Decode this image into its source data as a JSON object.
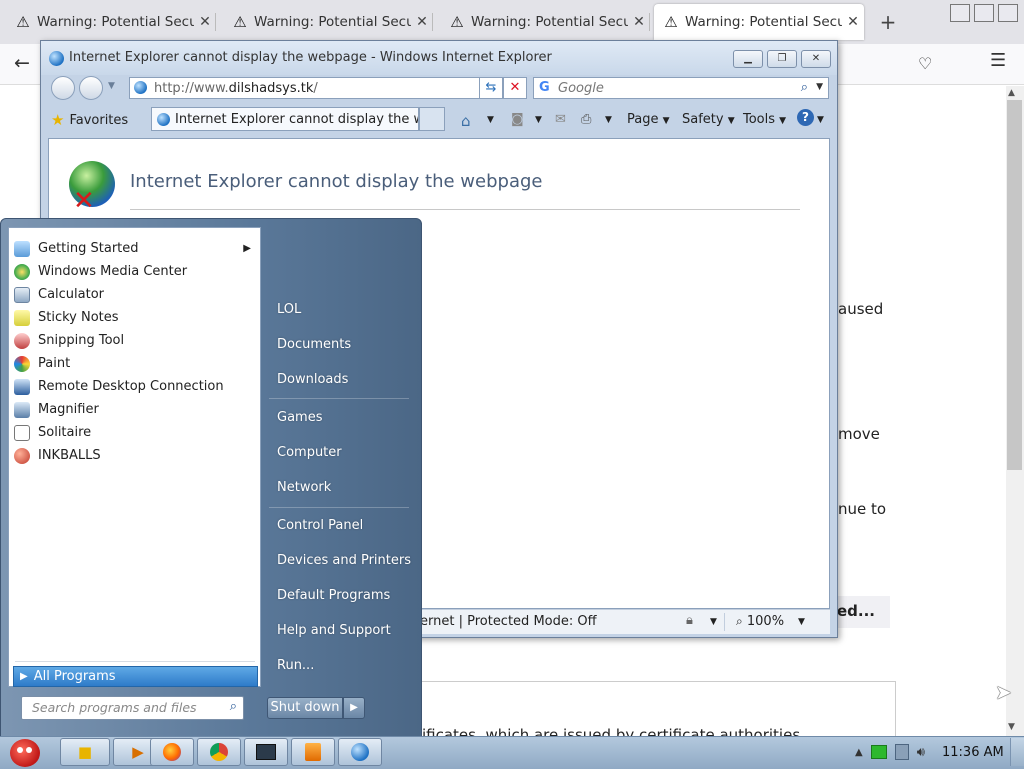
{
  "firefox": {
    "tabs": [
      {
        "title": "Warning: Potential Security Risk Ahead",
        "active": false
      },
      {
        "title": "Warning: Potential Security Risk Ahead",
        "active": false
      },
      {
        "title": "Warning: Potential Security Risk Ahead",
        "active": false
      },
      {
        "title": "Warning: Potential Security Risk Ahead",
        "active": true
      }
    ],
    "background_text": {
      "line1": "aused",
      "line2": "move",
      "line3": "nue to",
      "advanced_label": "ed...",
      "bottom_line": "ificates, which are issued by certificate authorities"
    }
  },
  "ie": {
    "window_title": "Internet Explorer cannot display the webpage - Windows Internet Explorer",
    "address_prefix": "http://www.",
    "address_domain": "dilshadsys.tk",
    "address_suffix": "/",
    "search_placeholder": "Google",
    "favorites_label": "Favorites",
    "tab_title": "Internet Explorer cannot display the we...",
    "commands": {
      "page": "Page",
      "safety": "Safety",
      "tools": "Tools"
    },
    "error_title": "Internet Explorer cannot display the webpage",
    "status_zone": "ernet | Protected Mode: Off",
    "zoom": "100%"
  },
  "start_menu": {
    "programs": [
      {
        "label": "Getting Started",
        "icon": "getting-started-icon",
        "has_submenu": true
      },
      {
        "label": "Windows Media Center",
        "icon": "media-center-icon",
        "has_submenu": false
      },
      {
        "label": "Calculator",
        "icon": "calculator-icon",
        "has_submenu": false
      },
      {
        "label": "Sticky Notes",
        "icon": "sticky-notes-icon",
        "has_submenu": false
      },
      {
        "label": "Snipping Tool",
        "icon": "snipping-tool-icon",
        "has_submenu": false
      },
      {
        "label": "Paint",
        "icon": "paint-icon",
        "has_submenu": false
      },
      {
        "label": "Remote Desktop Connection",
        "icon": "remote-desktop-icon",
        "has_submenu": false
      },
      {
        "label": "Magnifier",
        "icon": "magnifier-icon",
        "has_submenu": false
      },
      {
        "label": "Solitaire",
        "icon": "solitaire-icon",
        "has_submenu": false
      },
      {
        "label": "INKBALLS",
        "icon": "inkballs-icon",
        "has_submenu": false
      }
    ],
    "all_programs": "All Programs",
    "search_placeholder": "Search programs and files",
    "right_items": [
      {
        "label": "LOL"
      },
      {
        "label": "Documents"
      },
      {
        "label": "Downloads"
      },
      {
        "label": "Games"
      },
      {
        "label": "Computer"
      },
      {
        "label": "Network"
      },
      {
        "label": "Control Panel"
      },
      {
        "label": "Devices and Printers"
      },
      {
        "label": "Default Programs"
      },
      {
        "label": "Help and Support"
      },
      {
        "label": "Run..."
      }
    ],
    "shutdown_label": "Shut down"
  },
  "taskbar": {
    "clock": "11:36 AM",
    "pinned": [
      "explorer-icon",
      "media-player-icon",
      "firefox-icon",
      "chrome-icon",
      "terminal-icon",
      "app-icon",
      "internet-explorer-icon"
    ]
  },
  "colors": {
    "ie_frame": "#c4d3e6",
    "start_menu_right": "#5a7899",
    "all_programs_highlight": "#2e7bc9",
    "taskbar": "#9fb7cf"
  }
}
